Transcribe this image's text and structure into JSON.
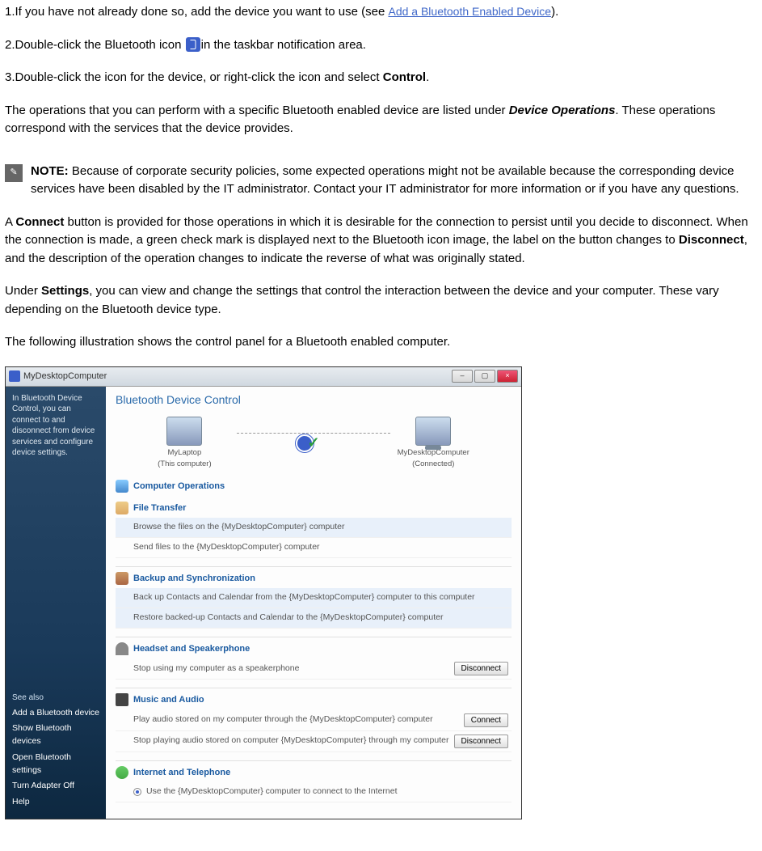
{
  "steps": {
    "s1_a": "1.If you have not already done so, add the device you want to use (see ",
    "s1_link": "Add a Bluetooth Enabled Device",
    "s1_b": ").",
    "s2_a": "2.Double-click the Bluetooth icon ",
    "s2_b": "in the taskbar notification area.",
    "s3_a": "3.Double-click the icon for the device, or right-click the icon and select ",
    "s3_bold": "Control",
    "s3_b": "."
  },
  "para1_a": "The operations that you can perform with a specific Bluetooth enabled device are listed under ",
  "para1_bold": "Device Operations",
  "para1_b": ". These operations correspond with the services that the device provides.",
  "note_label": "NOTE: ",
  "note_text": "Because of corporate security policies, some expected operations might not be available because the corresponding device services have been disabled by the IT administrator. Contact your IT administrator for more information or if you have any questions.",
  "para2_a": "A ",
  "para2_b1": "Connect",
  "para2_c": " button is provided for those operations in which it is desirable for the connection to persist until you decide to disconnect. When the connection is made, a green check mark is displayed next to the Bluetooth icon image, the label on the button changes to ",
  "para2_b2": "Disconnect",
  "para2_d": ", and the description of the operation changes to indicate the reverse of what was originally stated.",
  "para3_a": "Under ",
  "para3_bold": "Settings",
  "para3_b": ", you can view and change the settings that control the interaction between the device and your computer. These vary depending on the Bluetooth device type.",
  "para4": "The following illustration shows the control panel for a Bluetooth enabled computer.",
  "window": {
    "title": "MyDesktopComputer",
    "sidebar_top": "In Bluetooth Device Control, you can connect to and disconnect from device services and configure device settings.",
    "see_also": "See also",
    "links": [
      "Add a Bluetooth device",
      "Show Bluetooth devices",
      "Open Bluetooth settings",
      "Turn Adapter Off",
      "Help"
    ],
    "main_title": "Bluetooth Device Control",
    "dev1_name": "MyLaptop",
    "dev1_sub": "(This computer)",
    "dev2_name": "MyDesktopComputer",
    "dev2_sub": "(Connected)",
    "sections": {
      "comp": "Computer Operations",
      "file": "File Transfer",
      "file_ops": [
        "Browse the files on the {MyDesktopComputer} computer",
        "Send files to the {MyDesktopComputer} computer"
      ],
      "backup": "Backup and Synchronization",
      "backup_ops": [
        "Back up Contacts and Calendar from the {MyDesktopComputer} computer to this computer",
        "Restore backed-up Contacts and Calendar to the {MyDesktopComputer} computer"
      ],
      "headset": "Headset and Speakerphone",
      "headset_op": "Stop using my computer as a speakerphone",
      "music": "Music and Audio",
      "music_op1": "Play audio stored on my computer through the {MyDesktopComputer} computer",
      "music_op2": "Stop playing audio stored on computer {MyDesktopComputer} through my computer",
      "net": "Internet and Telephone",
      "net_op": "Use the {MyDesktopComputer} computer to connect to the Internet"
    },
    "btn_connect": "Connect",
    "btn_disconnect": "Disconnect"
  }
}
